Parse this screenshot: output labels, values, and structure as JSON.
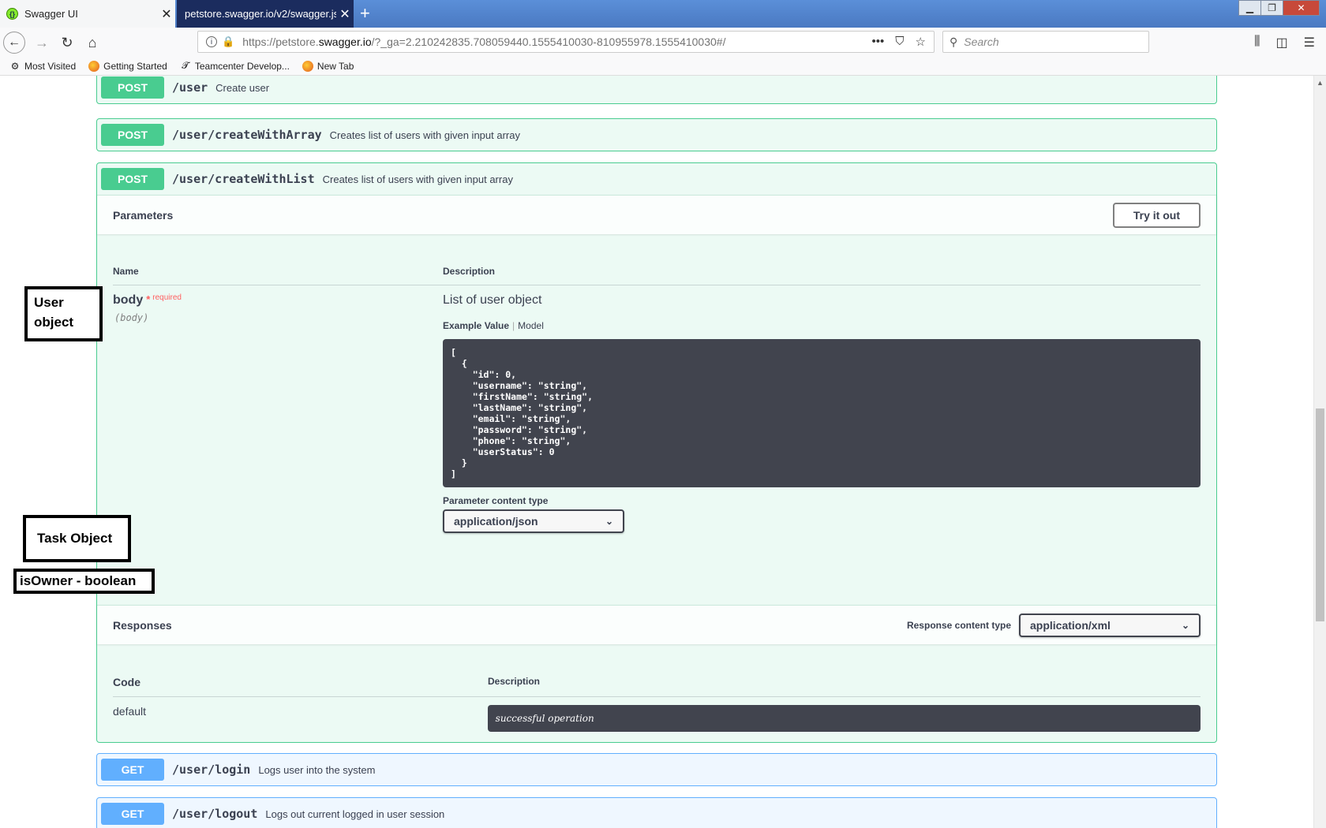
{
  "browser": {
    "tabs": [
      {
        "label": "Swagger UI",
        "active": true
      },
      {
        "label": "petstore.swagger.io/v2/swagger.json",
        "active": false
      }
    ],
    "url_prefix": "https://petstore.",
    "url_domain": "swagger.io",
    "url_suffix": "/?_ga=2.210242835.708059440.1555410030-810955978.1555410030#/",
    "search_placeholder": "Search",
    "bookmarks": [
      "Most Visited",
      "Getting Started",
      "Teamcenter Develop...",
      "New Tab"
    ]
  },
  "ops": [
    {
      "method": "POST",
      "path": "/user",
      "summary": "Create user"
    },
    {
      "method": "POST",
      "path": "/user/createWithArray",
      "summary": "Creates list of users with given input array"
    },
    {
      "method": "POST",
      "path": "/user/createWithList",
      "summary": "Creates list of users with given input array"
    },
    {
      "method": "GET",
      "path": "/user/login",
      "summary": "Logs user into the system"
    },
    {
      "method": "GET",
      "path": "/user/logout",
      "summary": "Logs out current logged in user session"
    }
  ],
  "expanded": {
    "parameters_title": "Parameters",
    "try_it_out": "Try it out",
    "col_name": "Name",
    "col_description": "Description",
    "param": {
      "name": "body",
      "required_star": "*",
      "required_label": "required",
      "in": "(body)",
      "description": "List of user object",
      "tab_example": "Example Value",
      "tab_model": "Model",
      "example": "[\n  {\n    \"id\": 0,\n    \"username\": \"string\",\n    \"firstName\": \"string\",\n    \"lastName\": \"string\",\n    \"email\": \"string\",\n    \"password\": \"string\",\n    \"phone\": \"string\",\n    \"userStatus\": 0\n  }\n]",
      "content_type_label": "Parameter content type",
      "content_type_value": "application/json"
    },
    "responses_title": "Responses",
    "response_content_type_label": "Response content type",
    "response_content_type_value": "application/xml",
    "resp_col_code": "Code",
    "resp_col_description": "Description",
    "responses": [
      {
        "code": "default",
        "description": "successful operation"
      }
    ]
  },
  "annotations": {
    "user_object": "User object",
    "task_object": "Task Object",
    "is_owner": "isOwner - boolean"
  }
}
